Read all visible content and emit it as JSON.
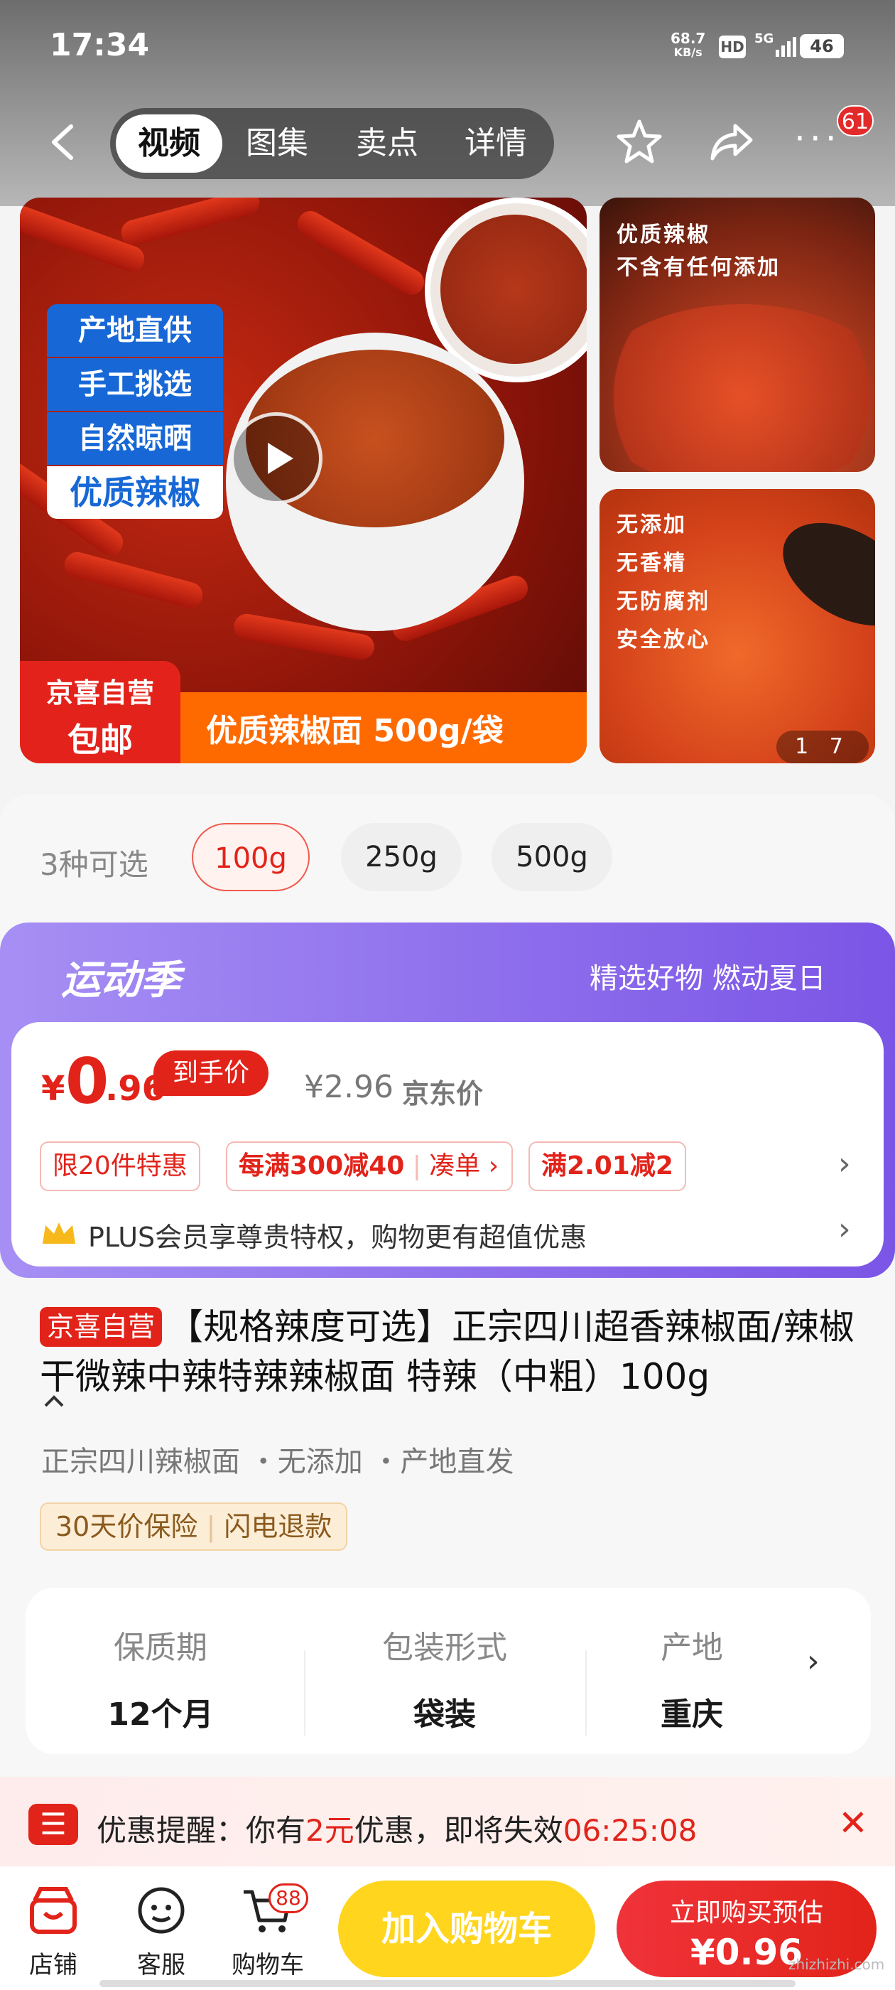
{
  "status_bar": {
    "time": "17:34",
    "net_speed": "68.7",
    "net_unit": "KB/s",
    "hd": "HD",
    "signal": "5G",
    "battery": "46"
  },
  "nav": {
    "tabs": [
      "视频",
      "图集",
      "卖点",
      "详情"
    ],
    "active_tab": 0,
    "more_badge": "61"
  },
  "gallery": {
    "badges": [
      "产地直供",
      "手工挑选",
      "自然晾晒",
      "优质辣椒"
    ],
    "store_badge_line1": "京喜自营",
    "store_badge_line2": "包邮",
    "banner": "优质辣椒面 500g/袋",
    "side1_text": [
      "优质辣椒",
      "不含有任何添加"
    ],
    "side2_text": [
      "无添加",
      "无香精",
      "无防腐剂",
      "安全放心"
    ],
    "pager": "1 7"
  },
  "spec": {
    "label": "3种可选",
    "options": [
      "100g",
      "250g",
      "500g"
    ],
    "selected": 0
  },
  "promo": {
    "campaign": "运动季",
    "slogan": "精选好物 燃动夏日",
    "price_symbol": "¥",
    "price_int": "0",
    "price_dec": ".96",
    "price_tag": "到手价",
    "jd_price": "¥2.96",
    "jd_label": "京东价",
    "coupons": [
      "限20件特惠",
      "每满300减40",
      "凑单 ›",
      "满2.01减2"
    ],
    "plus_text": "PLUS会员享尊贵特权，购物更有超值优惠"
  },
  "product": {
    "store_tag": "京喜自营",
    "title": "【规格辣度可选】正宗四川超香辣椒面/辣椒干微辣中辣特辣辣椒面 特辣（中粗）100g",
    "features": "正宗四川辣椒面 ・无添加 ・产地直发",
    "guarantee1": "30天价保险",
    "guarantee2": "闪电退款",
    "attrs": [
      {
        "k": "保质期",
        "v": "12个月"
      },
      {
        "k": "包装形式",
        "v": "袋装"
      },
      {
        "k": "产地",
        "v": "重庆"
      }
    ]
  },
  "notice": {
    "prefix": "优惠提醒：你有",
    "amount": "2元",
    "suffix": "优惠，即将失效",
    "countdown": "06:25:08"
  },
  "bottom": {
    "store": "店铺",
    "service": "客服",
    "cart": "购物车",
    "cart_count": "88",
    "add_cart": "加入购物车",
    "buy_line1": "立即购买预估",
    "buy_line2": "¥0.96"
  },
  "watermark": "zhizhizhi.com"
}
